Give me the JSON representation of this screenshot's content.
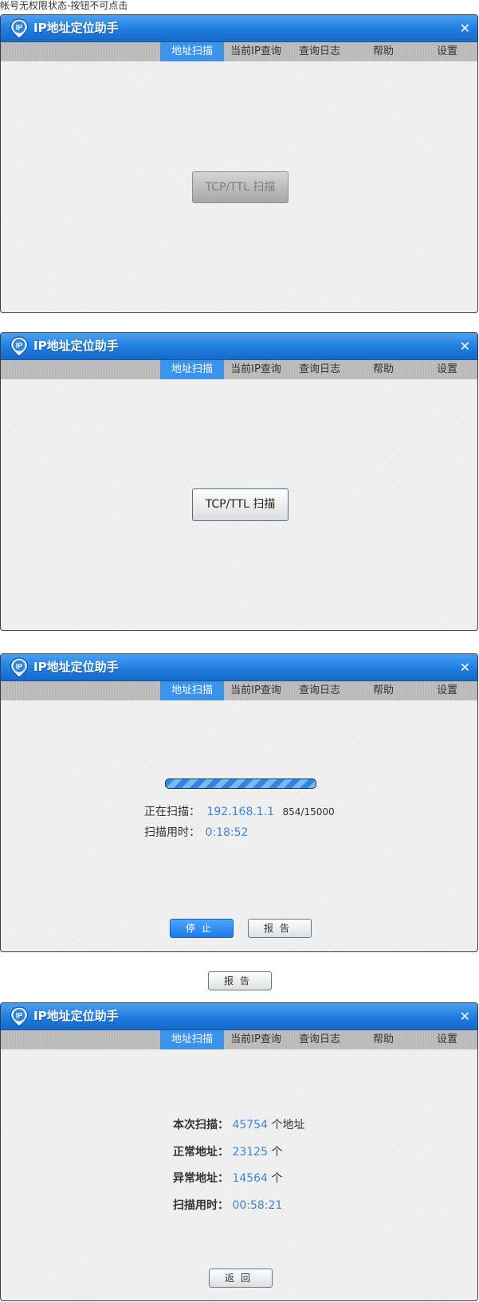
{
  "caption": "帐号无权限状态-按钮不可点击",
  "window": {
    "title": "IP地址定位助手",
    "close": "✕",
    "logo_text": "IP",
    "tabs": [
      "地址扫描",
      "当前IP查询",
      "查询日志",
      "帮助",
      "设置"
    ],
    "active_tab": "地址扫描"
  },
  "screen1": {
    "scan_button": "TCP/TTL 扫描"
  },
  "screen2": {
    "scan_button": "TCP/TTL 扫描"
  },
  "screen3": {
    "progress": 1.0,
    "scanning_label": "正在扫描：",
    "scanning_ip": "192.168.1.1",
    "scanning_count": "854/15000",
    "elapsed_label": "扫描用时：",
    "elapsed_value": "0:18:52",
    "stop_button": "停止",
    "report_button": "报告"
  },
  "standalone_report_button": "报告",
  "screen4": {
    "total_label": "本次扫描：",
    "total_value": "45754",
    "total_unit": "个地址",
    "normal_label": "正常地址：",
    "normal_value": "23125",
    "normal_unit": "个",
    "abnormal_label": "异常地址：",
    "abnormal_value": "14564",
    "abnormal_unit": "个",
    "elapsed_label": "扫描用时：",
    "elapsed_value": "00:58:21",
    "back_button": "返回"
  },
  "colors": {
    "titlebar": "#1f7de0",
    "active_tab": "#3b93ec",
    "value_text": "#3b86d8"
  }
}
